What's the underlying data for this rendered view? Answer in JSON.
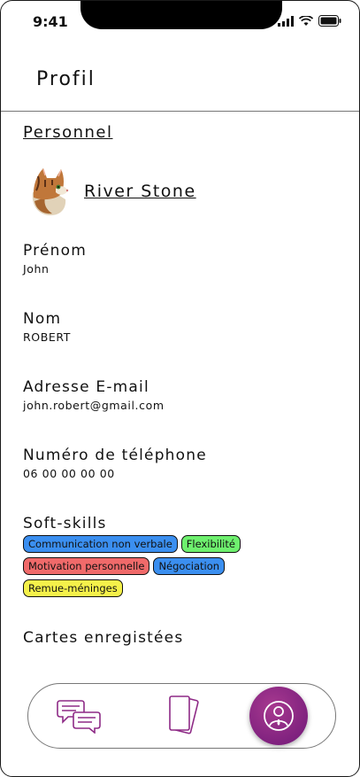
{
  "status": {
    "time": "9:41"
  },
  "header": {
    "title": "Profil"
  },
  "section": {
    "title": "Personnel"
  },
  "user": {
    "name": "River Stone"
  },
  "fields": [
    {
      "label": "Prénom",
      "value": "John"
    },
    {
      "label": "Nom",
      "value": "ROBERT"
    },
    {
      "label": "Adresse E-mail",
      "value": "john.robert@gmail.com"
    },
    {
      "label": "Numéro de téléphone",
      "value": "06 00 00 00 00"
    }
  ],
  "soft_skills": {
    "label": "Soft-skills",
    "tags": [
      {
        "label": "Communication non verbale",
        "color": "#3b8ff0"
      },
      {
        "label": "Flexibilité",
        "color": "#6ef06e"
      },
      {
        "label": "Motivation personnelle",
        "color": "#f06a6a"
      },
      {
        "label": "Négociation",
        "color": "#3b8ff0"
      },
      {
        "label": "Remue-méninges",
        "color": "#f5f14a"
      }
    ]
  },
  "cards": {
    "label": "Cartes enregistées"
  },
  "nav": {
    "items": [
      "chat-icon",
      "cards-icon",
      "profile-icon"
    ],
    "active": "profile-icon",
    "accent": "#8e2a86"
  }
}
